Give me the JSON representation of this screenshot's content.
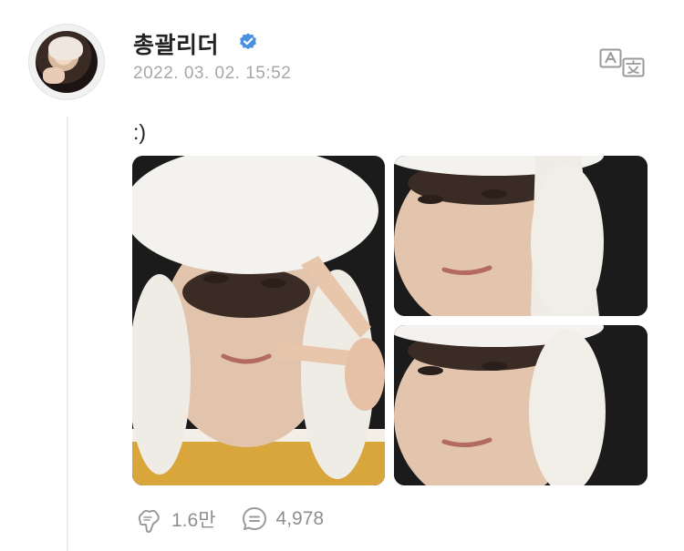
{
  "post": {
    "author": {
      "name": "총괄리더",
      "verified": true,
      "avatar_icon": "avatar"
    },
    "timestamp": "2022. 03. 02. 15:52",
    "text": ":)",
    "photos": [
      {
        "name": "photo-large"
      },
      {
        "name": "photo-top-right"
      },
      {
        "name": "photo-bottom-right"
      }
    ],
    "actions": {
      "likes": "1.6만",
      "comments": "4,978"
    }
  },
  "icons": {
    "verified": "verified-badge-icon",
    "translate": "translate-icon",
    "like": "like-icon",
    "comment": "comment-icon"
  },
  "colors": {
    "verified": "#4a90e2",
    "text": "#222222",
    "muted": "#a7a7a7",
    "action": "#8e8e8e"
  }
}
